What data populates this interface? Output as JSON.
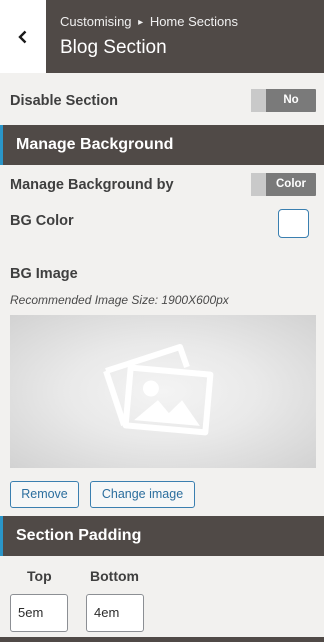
{
  "header": {
    "breadcrumb_parent": "Customising",
    "breadcrumb_sep": "▸",
    "breadcrumb_child": "Home Sections",
    "title": "Blog Section",
    "back_icon": "chevron-left-icon"
  },
  "disable_section": {
    "label": "Disable Section",
    "value": "No"
  },
  "manage_background": {
    "heading": "Manage Background",
    "by_label": "Manage Background by",
    "by_value": "Color",
    "bg_color_label": "BG Color",
    "bg_color_value": "#ffffff",
    "bg_image_label": "BG Image",
    "bg_image_hint": "Recommended Image Size: 1900X600px",
    "image_placeholder_icon": "image-placeholder-icon",
    "remove_label": "Remove",
    "change_label": "Change image"
  },
  "section_padding": {
    "heading": "Section Padding",
    "top_label": "Top",
    "top_value": "5em",
    "bottom_label": "Bottom",
    "bottom_value": "4em"
  },
  "colors": {
    "header_bg": "#504a47",
    "accent": "#2a96c9",
    "button_border": "#3a7fb0",
    "toggle_bg": "#7a7a7a"
  }
}
